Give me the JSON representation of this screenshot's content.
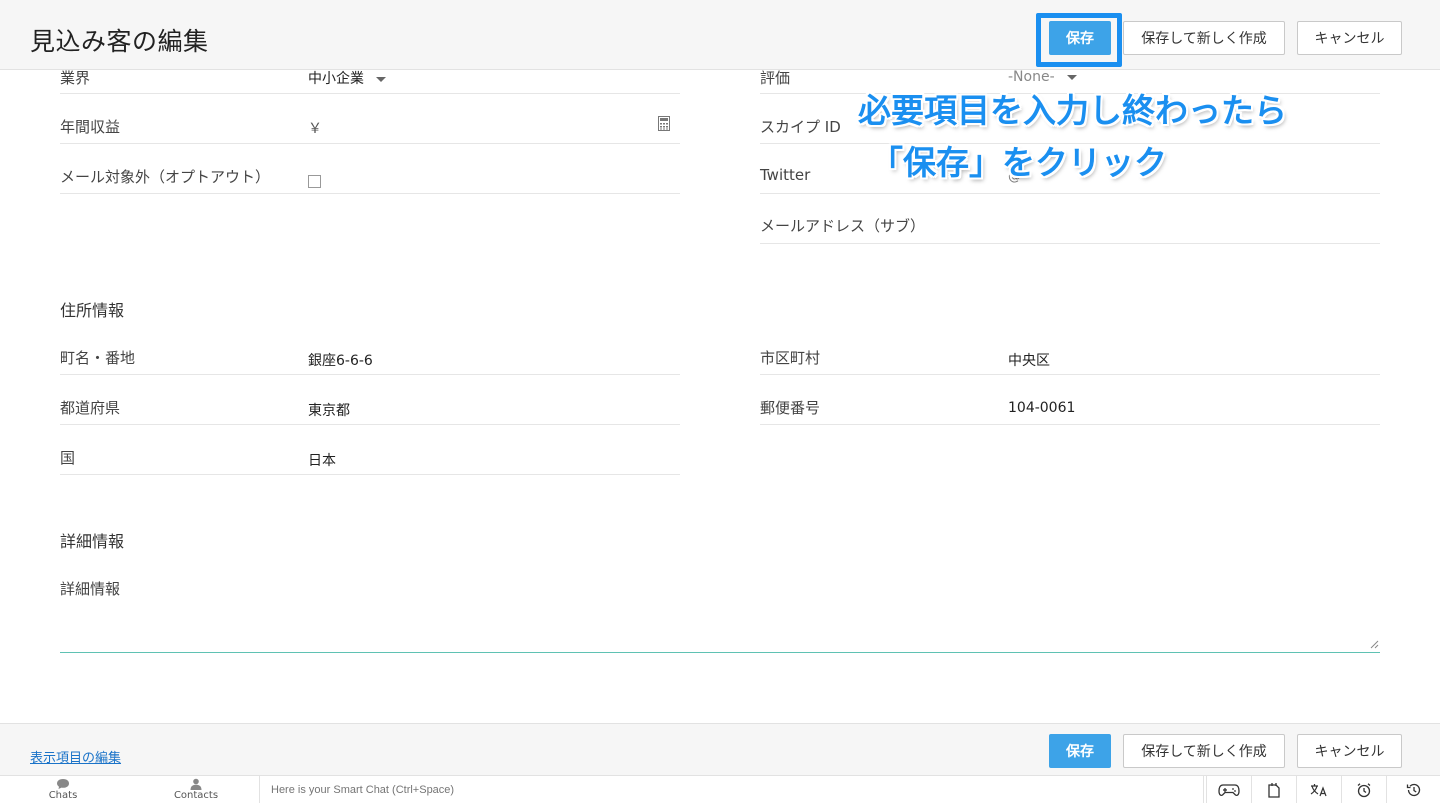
{
  "header": {
    "title": "見込み客の編集",
    "save_label": "保存",
    "save_new_label": "保存して新しく作成",
    "cancel_label": "キャンセル"
  },
  "fields_top": {
    "industry": {
      "label": "業界",
      "value": "中小企業"
    },
    "annual_revenue": {
      "label": "年間収益",
      "value": "￥"
    },
    "email_opt_out": {
      "label": "メール対象外（オプトアウト）",
      "checked": false
    },
    "rating": {
      "label": "評価",
      "value": "-None-"
    },
    "skype": {
      "label": "スカイプ ID",
      "value": ""
    },
    "twitter": {
      "label": "Twitter",
      "value": "@"
    },
    "secondary_email": {
      "label": "メールアドレス（サブ）",
      "value": ""
    }
  },
  "address": {
    "section_title": "住所情報",
    "street": {
      "label": "町名・番地",
      "value": "銀座6-6-6"
    },
    "city": {
      "label": "市区町村",
      "value": "中央区"
    },
    "state": {
      "label": "都道府県",
      "value": "東京都"
    },
    "zip": {
      "label": "郵便番号",
      "value": "104-0061"
    },
    "country": {
      "label": "国",
      "value": "日本"
    }
  },
  "details": {
    "section_title": "詳細情報",
    "description": {
      "label": "詳細情報",
      "value": ""
    }
  },
  "annotation": {
    "line1": "必要項目を入力し終わったら",
    "line2": "「保存」をクリック",
    "color": "#1a8ff0"
  },
  "footer": {
    "edit_layout_link": "表示項目の編集",
    "save_label": "保存",
    "save_new_label": "保存して新しく作成",
    "cancel_label": "キャンセル"
  },
  "bottombar": {
    "chats_label": "Chats",
    "contacts_label": "Contacts",
    "smartchat_placeholder": "Here is your Smart Chat (Ctrl+Space)",
    "icons": [
      "gamepad-icon",
      "notes-icon",
      "translate-icon",
      "alarm-icon",
      "history-icon"
    ]
  },
  "colors": {
    "primary": "#3da3e8",
    "link": "#1a73c8",
    "focus_line": "#5fc2b3"
  }
}
